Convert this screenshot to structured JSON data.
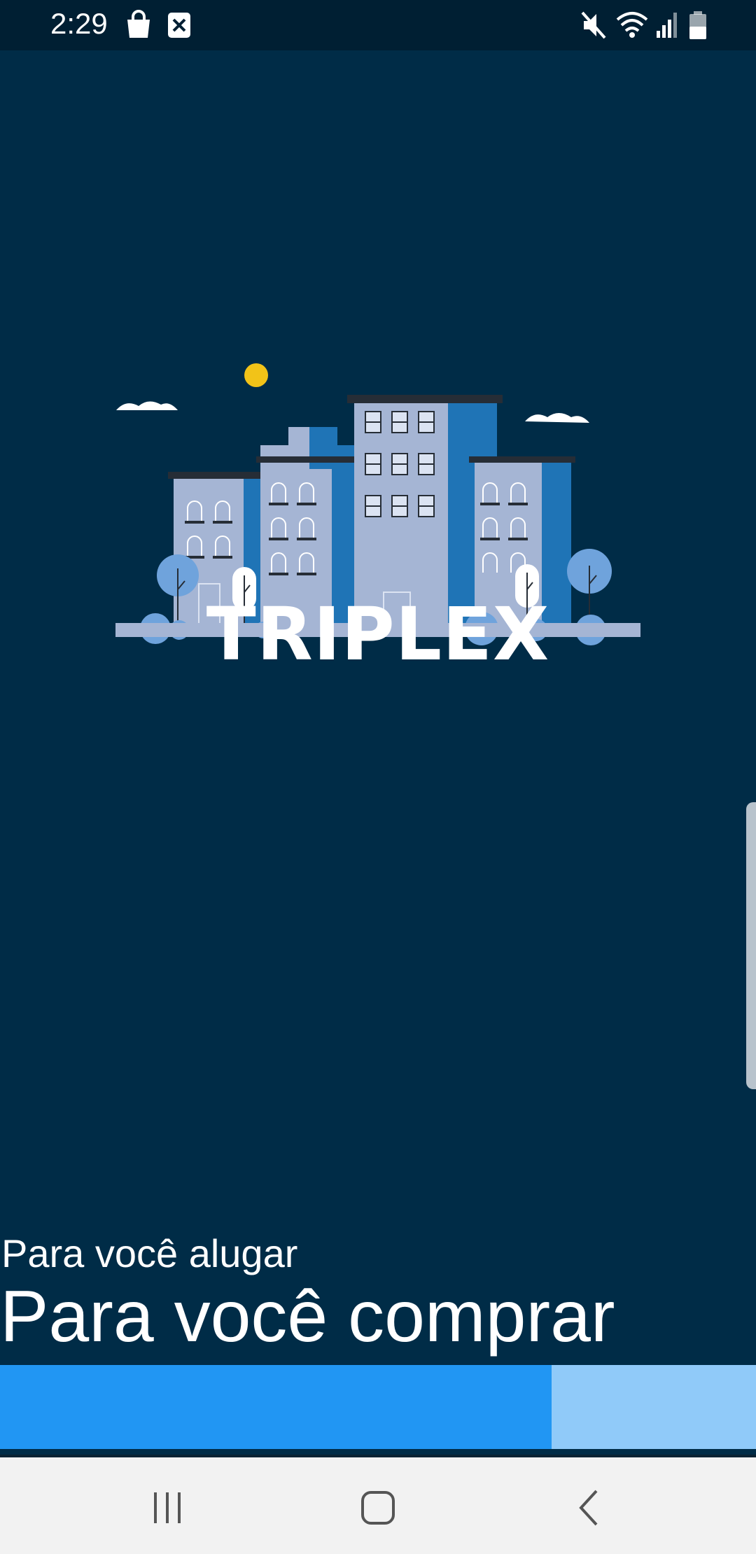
{
  "status_bar": {
    "time": "2:29",
    "left_icons": [
      "shopping-bag-icon",
      "close-box-icon"
    ],
    "right_icons": [
      "mute-icon",
      "wifi-icon",
      "signal-icon",
      "battery-icon"
    ]
  },
  "splash": {
    "brand_name": "TRIPLEX",
    "illustration": "city-buildings-illustration",
    "tagline_small": "Para você alugar",
    "tagline_large": "Para você comprar"
  },
  "progress": {
    "value": 0.73,
    "fill_color": "#2196f3",
    "track_color": "#90caf9"
  },
  "colors": {
    "background": "#002c47",
    "sun": "#f2c318"
  },
  "nav_bar": {
    "buttons": [
      "recent-apps-icon",
      "home-icon",
      "back-icon"
    ]
  }
}
